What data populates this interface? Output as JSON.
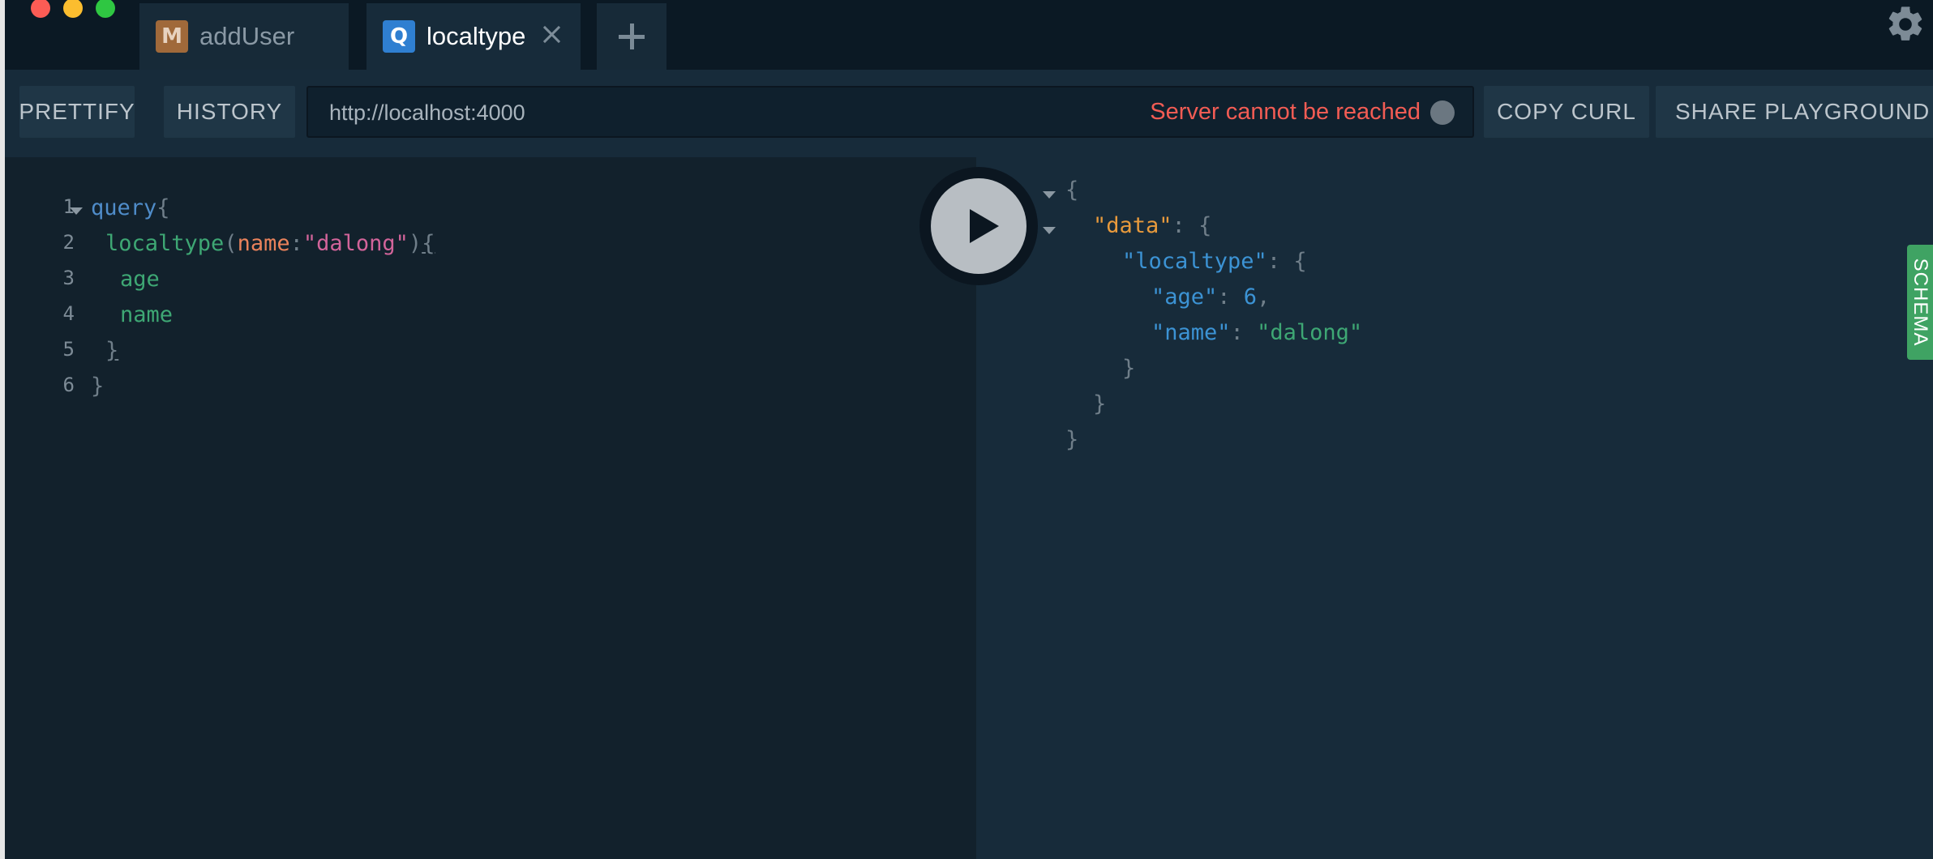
{
  "tabs": [
    {
      "badge": "M",
      "label": "addUser"
    },
    {
      "badge": "Q",
      "label": "localtype"
    }
  ],
  "toolbar": {
    "prettify": "PRETTIFY",
    "history": "HISTORY",
    "url": "http://localhost:4000",
    "status": "Server cannot be reached",
    "copy_curl": "COPY CURL",
    "share": "SHARE PLAYGROUND"
  },
  "editor": {
    "line_numbers": [
      "1",
      "2",
      "3",
      "4",
      "5",
      "6"
    ],
    "l1_kw": "query",
    "l1_brace": "{",
    "l2_field": "localtype",
    "l2_paren_open": "(",
    "l2_arg": "name",
    "l2_colon": ":",
    "l2_str": "\"dalong\"",
    "l2_paren_close": ")",
    "l2_brace": "{",
    "l3_field": "age",
    "l4_field": "name",
    "l5_brace": "}",
    "l6_brace": "}"
  },
  "result": {
    "open": "{",
    "data_key": "\"data\"",
    "colon": ": ",
    "data_open": "{",
    "localtype_key": "\"localtype\"",
    "localtype_open": "{",
    "age_key": "\"age\"",
    "age_val": "6",
    "comma": ",",
    "name_key": "\"name\"",
    "name_val": "\"dalong\"",
    "close_inner": "}",
    "close_data": "}",
    "close_root": "}"
  },
  "schema": {
    "label": "SCHEMA"
  },
  "colors": {
    "status_error": "#f25c54",
    "schema_tab": "#3fa363",
    "accent_blue": "#2f7fd1"
  },
  "icons": {
    "settings": "gear-icon",
    "run": "play-icon",
    "add_tab": "plus-icon",
    "close_tab": "close-icon"
  }
}
